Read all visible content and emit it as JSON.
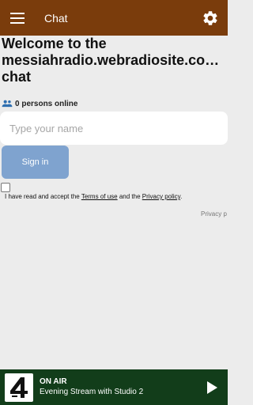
{
  "appbar": {
    "title": "Chat",
    "menu_icon": "menu-icon",
    "settings_icon": "gear-icon",
    "color": "#7a3c0c"
  },
  "main": {
    "welcome_line1": "Welcome to the",
    "welcome_line2": "messiahradio.webradiosite.co…",
    "welcome_line3": "chat",
    "online_count": "0 persons online",
    "name_placeholder": "Type your name",
    "signin_label": "Sign in",
    "signin_color": "#7fa3cf",
    "terms_prefix": "I have read and accept the ",
    "terms_link": "Terms of use",
    "terms_middle": " and the ",
    "privacy_link": "Privacy policy",
    "terms_suffix": ".",
    "privacy_cut": "Privacy p"
  },
  "player": {
    "status": "ON AIR",
    "stream": "Evening Stream with Studio 2",
    "color": "#123d1a",
    "play_icon": "play-icon"
  }
}
